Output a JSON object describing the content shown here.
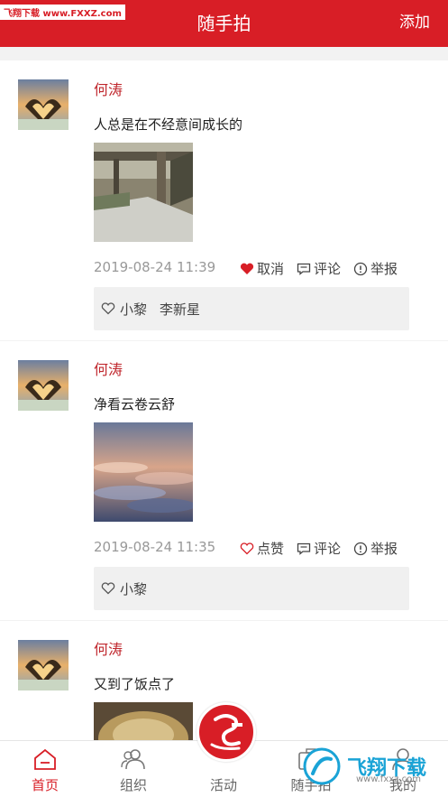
{
  "header": {
    "title": "随手拍",
    "add_label": "添加",
    "watermark": "飞翔下载 www.FXXZ.com"
  },
  "posts": [
    {
      "user": "何涛",
      "text": "人总是在不经意间成长的",
      "time": "2019-08-24 11:39",
      "like_label": "取消",
      "liked": true,
      "comment_label": "评论",
      "report_label": "举报",
      "likers": [
        "小黎",
        "李新星"
      ]
    },
    {
      "user": "何涛",
      "text": "净看云卷云舒",
      "time": "2019-08-24 11:35",
      "like_label": "点赞",
      "liked": false,
      "comment_label": "评论",
      "report_label": "举报",
      "likers": [
        "小黎"
      ]
    },
    {
      "user": "何涛",
      "text": "又到了饭点了"
    }
  ],
  "tabs": [
    {
      "label": "首页",
      "icon": "home-icon",
      "active": true
    },
    {
      "label": "组织",
      "icon": "people-icon",
      "active": false
    },
    {
      "label": "活动",
      "icon": "logo-icon",
      "active": false
    },
    {
      "label": "随手拍",
      "icon": "camera-icon",
      "active": false
    },
    {
      "label": "我的",
      "icon": "user-icon",
      "active": false
    }
  ],
  "watermark_logo": {
    "text": "飞翔下载",
    "url": "www.fxxz.com"
  },
  "colors": {
    "primary": "#d81e26",
    "username": "#c0272d"
  }
}
